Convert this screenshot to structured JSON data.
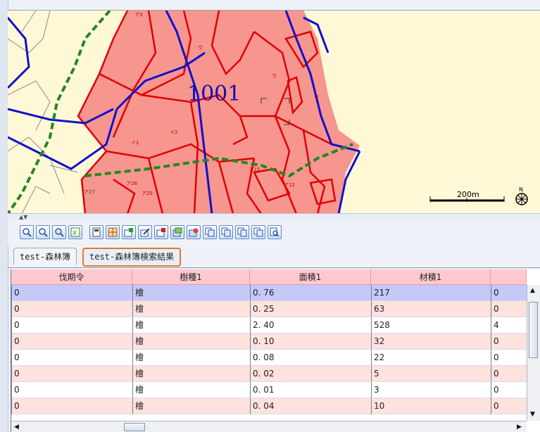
{
  "map": {
    "area_label": "1001",
    "scale_label": "200m",
    "north_label": "N",
    "parcel_labels": [
      "ア3",
      "ウ",
      "ウ",
      "ウ",
      "イ1",
      "イ2",
      "ア15",
      "ア26",
      "ア25",
      "ア12",
      "ア27"
    ],
    "colors": {
      "forest": "#f7958f",
      "boundary": "#1010cc",
      "parcel_line": "#e00000",
      "trail": "#228822",
      "background": "#fff8d6"
    }
  },
  "toolbar": {
    "buttons": [
      "zoom-in-icon",
      "zoom-out-icon",
      "zoom-select-icon",
      "excel-export-icon",
      "calculator-icon",
      "map-grid-icon",
      "add-record-icon",
      "edit-record-icon",
      "delete-record-icon",
      "layer-icon",
      "clear-icon",
      "copy-icon",
      "copy-icon",
      "copy-icon",
      "copy-icon",
      "search-icon"
    ]
  },
  "tabs": [
    {
      "label": "test-森林簿",
      "active": false
    },
    {
      "label": "test-森林簿検索結果",
      "active": true
    }
  ],
  "table": {
    "columns": [
      "伐期令",
      "樹種1",
      "面積1",
      "材積1",
      ""
    ],
    "rows": [
      [
        "0",
        "檜",
        "0. 76",
        "217",
        "0"
      ],
      [
        "0",
        "檜",
        "0. 25",
        "63",
        "0"
      ],
      [
        "0",
        "檜",
        "2. 40",
        "528",
        "4"
      ],
      [
        "0",
        "檜",
        "0. 10",
        "32",
        "0"
      ],
      [
        "0",
        "檜",
        "0. 08",
        "22",
        "0"
      ],
      [
        "0",
        "檜",
        "0. 02",
        "5",
        "0"
      ],
      [
        "0",
        "檜",
        "0. 01",
        "3",
        "0"
      ],
      [
        "0",
        "檜",
        "0. 04",
        "10",
        "0"
      ]
    ],
    "selected_row": 0
  }
}
